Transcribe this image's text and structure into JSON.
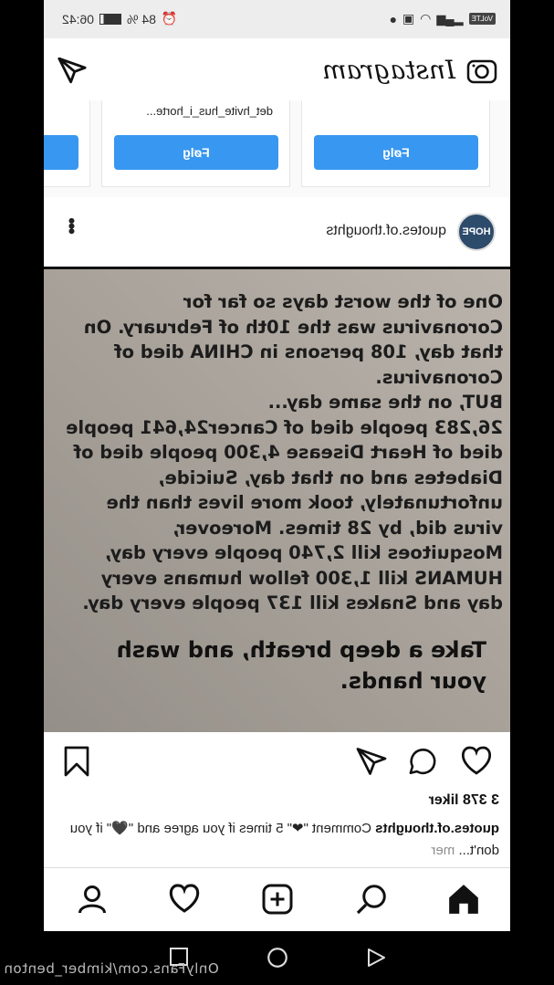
{
  "status_bar": {
    "time": "06:42",
    "battery": "84 %",
    "volte": "VoLTE"
  },
  "app": {
    "logo_text": "Instagram"
  },
  "suggestions": [
    {
      "name": "",
      "button": "Følg"
    },
    {
      "name": "det_hvite_hus_i_horte...",
      "button": "Følg"
    },
    {
      "name": "",
      "button": ""
    }
  ],
  "post": {
    "avatar_text": "HOPE",
    "username": "quotes.of.thoughts",
    "image_text": "One of the worst days so far for\nCoronavirus was the 10th of February. On\nthat day, 108 persons in CHINA died of\nCoronavirus.\nBUT, on the same day...\n26,283 people died of Cancer24,641 people\ndied of Heart Disease 4,300 people died of\nDiabetes and on that day, Suicide,\nunfortunately, took more lives than the\nvirus did, by 28 times. Moreover,\nMosquitoes kill 2,740 people every day,\nHUMANS kill 1,300 fellow humans every\nday and Snakes kill 137 people every day.",
    "image_text_big": "Take a deep breath, and wash\nyour hands.",
    "likes": "3 378 liker",
    "caption_user": "quotes.of.thoughts",
    "caption_text": "Comment \"❤\" 5 times if you agree and \"🖤\" if you don't...",
    "caption_more": "mer"
  },
  "watermark": "OnlyFans.com/kimber_benton",
  "colors": {
    "accent": "#3897f0",
    "heart_red": "#d62d2d"
  },
  "icons": {
    "header_left": "direct-message-icon",
    "header_right": "camera-icon",
    "actions": [
      "like-icon",
      "comment-icon",
      "share-icon",
      "save-icon"
    ],
    "nav": [
      "home-icon",
      "search-icon",
      "add-post-icon",
      "activity-icon",
      "profile-icon"
    ],
    "system": [
      "back-icon",
      "home-circle-icon",
      "recents-icon"
    ]
  }
}
